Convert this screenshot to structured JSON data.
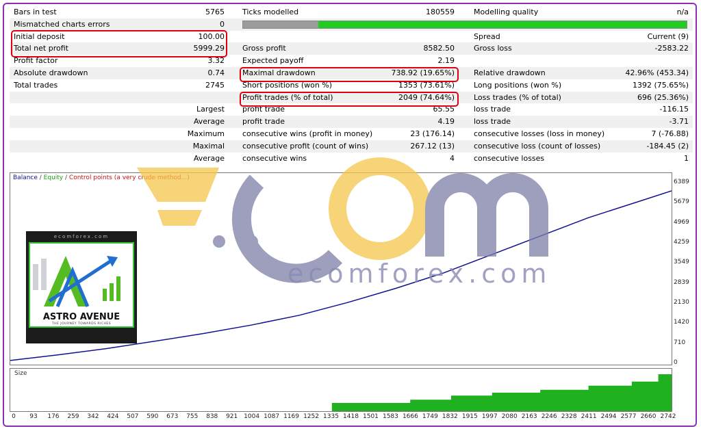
{
  "report": {
    "rows": [
      {
        "c1_label": "Bars in test",
        "c1_value": "5765",
        "c2_label": "Ticks modelled",
        "c2_value": "180559",
        "c3_label": "Modelling quality",
        "c3_value": "n/a",
        "shade": false
      },
      {
        "c1_label": "Mismatched charts errors",
        "c1_value": "0",
        "quality_bar": true,
        "shade": true
      },
      {
        "c1_label": "Initial deposit",
        "c1_value": "100.00",
        "c2_label": "",
        "c2_value": "",
        "c3_label": "Spread",
        "c3_value": "Current (9)",
        "shade": false
      },
      {
        "c1_label": "Total net profit",
        "c1_value": "5999.29",
        "c2_label": "Gross profit",
        "c2_value": "8582.50",
        "c3_label": "Gross loss",
        "c3_value": "-2583.22",
        "shade": true
      },
      {
        "c1_label": "Profit factor",
        "c1_value": "3.32",
        "c2_label": "Expected payoff",
        "c2_value": "2.19",
        "c3_label": "",
        "c3_value": "",
        "shade": false
      },
      {
        "c1_label": "Absolute drawdown",
        "c1_value": "0.74",
        "c2_label": "Maximal drawdown",
        "c2_value": "738.92 (19.65%)",
        "c3_label": "Relative drawdown",
        "c3_value": "42.96% (453.34)",
        "shade": true
      },
      {
        "c1_label": "Total trades",
        "c1_value": "2745",
        "c2_label": "Short positions (won %)",
        "c2_value": "1353 (73.61%)",
        "c3_label": "Long positions (won %)",
        "c3_value": "1392 (75.65%)",
        "shade": false
      },
      {
        "c1_label": "",
        "c1_value": "",
        "c2_label": "Profit trades (% of total)",
        "c2_value": "2049 (74.64%)",
        "c3_label": "Loss trades (% of total)",
        "c3_value": "696 (25.36%)",
        "shade": true
      },
      {
        "c1_label": "",
        "c1_value": "Largest",
        "c2_label": "profit trade",
        "c2_value": "65.55",
        "c3_label": "loss trade",
        "c3_value": "-116.15",
        "shade": false
      },
      {
        "c1_label": "",
        "c1_value": "Average",
        "c2_label": "profit trade",
        "c2_value": "4.19",
        "c3_label": "loss trade",
        "c3_value": "-3.71",
        "shade": true
      },
      {
        "c1_label": "",
        "c1_value": "Maximum",
        "c2_label": "consecutive wins (profit in money)",
        "c2_value": "23 (176.14)",
        "c3_label": "consecutive losses (loss in money)",
        "c3_value": "7 (-76.88)",
        "shade": false
      },
      {
        "c1_label": "",
        "c1_value": "Maximal",
        "c2_label": "consecutive profit (count of wins)",
        "c2_value": "267.12 (13)",
        "c3_label": "consecutive loss (count of losses)",
        "c3_value": "-184.45 (2)",
        "shade": true
      },
      {
        "c1_label": "",
        "c1_value": "Average",
        "c2_label": "consecutive wins",
        "c2_value": "4",
        "c3_label": "consecutive losses",
        "c3_value": "1",
        "shade": false
      }
    ],
    "quality_bar_fraction": 0.17
  },
  "chart_legend": {
    "balance": "Balance",
    "equity": "Equity",
    "control": "Control points (a very crude method...)",
    "sep": " / "
  },
  "chart_data": {
    "type": "line",
    "series": [
      {
        "name": "Balance",
        "x": [
          0,
          200,
          400,
          600,
          800,
          1000,
          1200,
          1400,
          1600,
          1800,
          2000,
          2200,
          2400,
          2600,
          2745
        ],
        "values": [
          100,
          300,
          520,
          780,
          1050,
          1350,
          1700,
          2150,
          2650,
          3200,
          3850,
          4500,
          5150,
          5700,
          6099
        ]
      }
    ],
    "y_ticks": [
      "6389",
      "5679",
      "4969",
      "4259",
      "3549",
      "2839",
      "2130",
      "1420",
      "710",
      "0"
    ],
    "x_ticks": [
      "0",
      "93",
      "176",
      "259",
      "342",
      "424",
      "507",
      "590",
      "673",
      "755",
      "838",
      "921",
      "1004",
      "1087",
      "1169",
      "1252",
      "1335",
      "1418",
      "1501",
      "1583",
      "1666",
      "1749",
      "1832",
      "1915",
      "1997",
      "2080",
      "2163",
      "2246",
      "2328",
      "2411",
      "2494",
      "2577",
      "2660",
      "2742"
    ],
    "ylim": [
      0,
      6389
    ],
    "xlim": [
      0,
      2745
    ]
  },
  "size_panel": {
    "label": "Size",
    "steps": [
      [
        0,
        0
      ],
      [
        1335,
        0.2
      ],
      [
        1660,
        0.28
      ],
      [
        1830,
        0.38
      ],
      [
        2000,
        0.45
      ],
      [
        2200,
        0.52
      ],
      [
        2400,
        0.62
      ],
      [
        2580,
        0.72
      ],
      [
        2690,
        0.9
      ],
      [
        2745,
        0.95
      ]
    ]
  },
  "watermark": {
    "text": "ecomforex.com"
  },
  "logo": {
    "top": "ecomforex.com",
    "name": "ASTRO AVENUE",
    "tagline": "THE JOURNEY TOWARDS RICHES"
  },
  "colors": {
    "balance": "#101090",
    "equity": "#18a018",
    "control": "#d01010",
    "highlight": "#e00010",
    "size_fill": "#1fb11f",
    "frame": "#8b2fb8"
  }
}
